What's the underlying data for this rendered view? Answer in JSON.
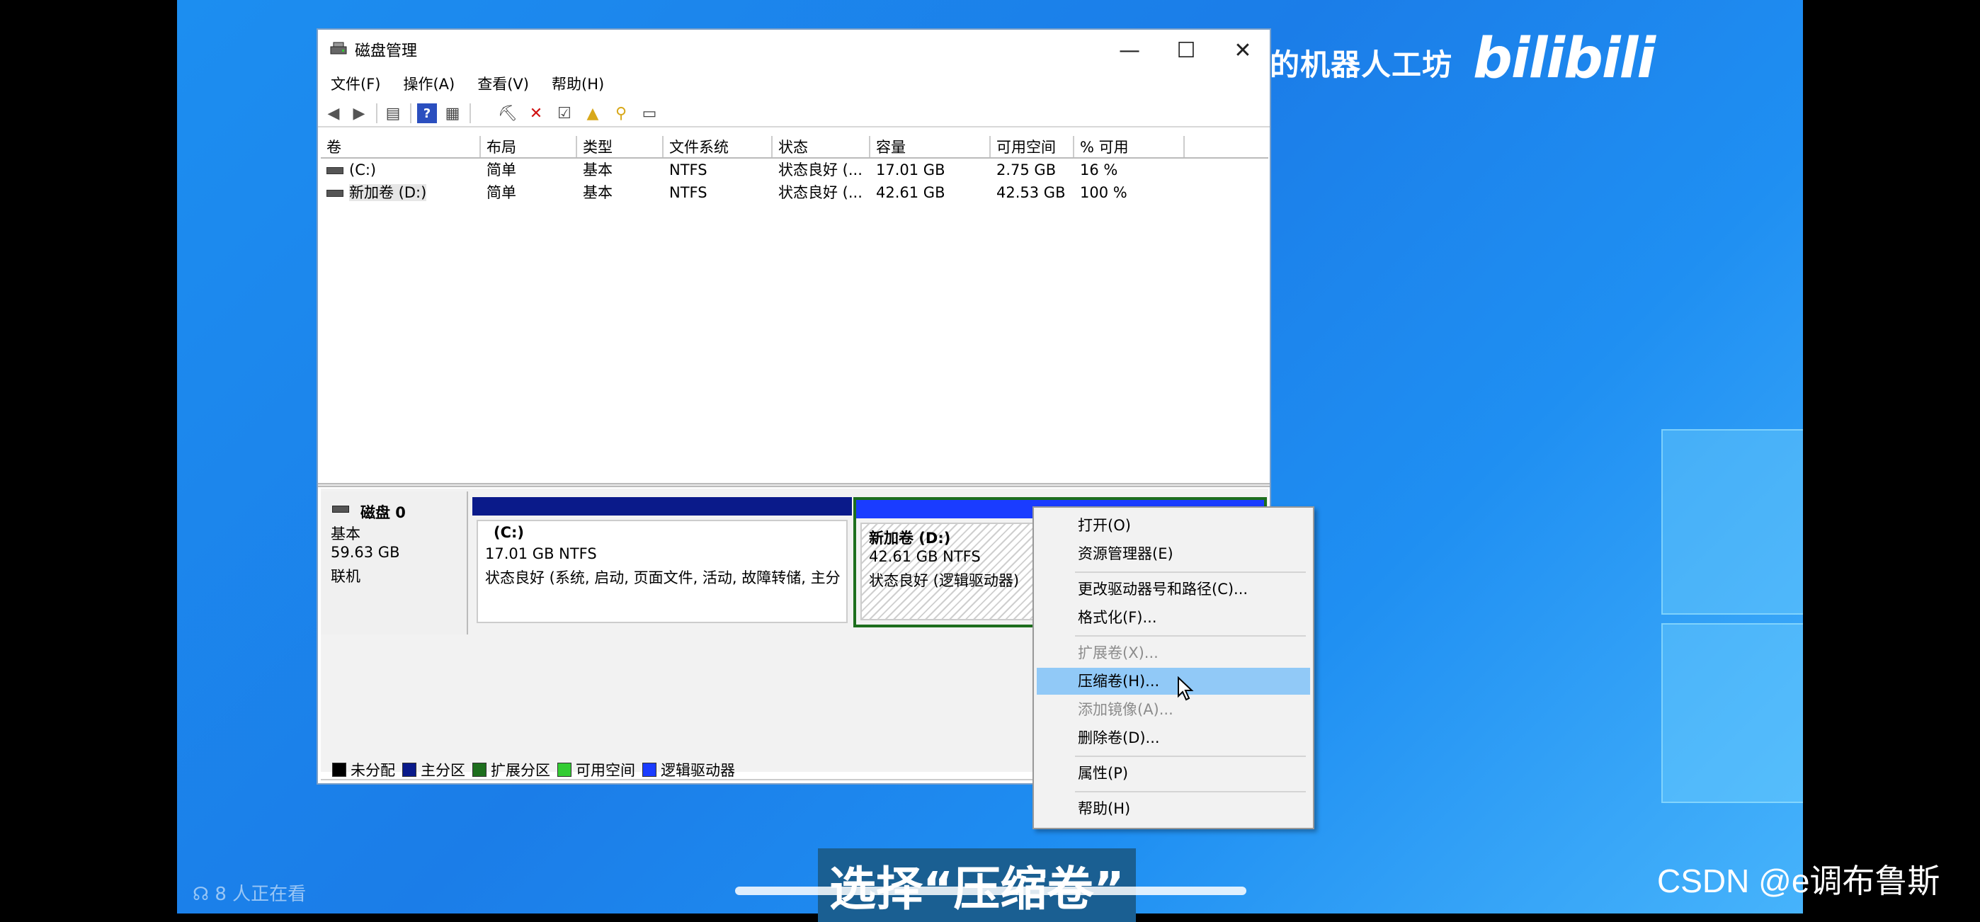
{
  "window": {
    "title": "磁盘管理"
  },
  "menu": [
    "文件(F)",
    "操作(A)",
    "查看(V)",
    "帮助(H)"
  ],
  "columns": [
    "卷",
    "布局",
    "类型",
    "文件系统",
    "状态",
    "容量",
    "可用空间",
    "% 可用"
  ],
  "volumes": [
    {
      "name": "(C:)",
      "layout": "简单",
      "type": "基本",
      "fs": "NTFS",
      "status": "状态良好 (...",
      "capacity": "17.01 GB",
      "free": "2.75 GB",
      "pct": "16 %"
    },
    {
      "name": "新加卷 (D:)",
      "layout": "简单",
      "type": "基本",
      "fs": "NTFS",
      "status": "状态良好 (...",
      "capacity": "42.61 GB",
      "free": "42.53 GB",
      "pct": "100 %"
    }
  ],
  "disk": {
    "name": "磁盘 0",
    "type": "基本",
    "size": "59.63 GB",
    "state": "联机"
  },
  "partitions": {
    "c": {
      "title": "(C:)",
      "size": "17.01 GB NTFS",
      "status": "状态良好 (系统, 启动, 页面文件, 活动, 故障转储, 主分"
    },
    "d": {
      "title": "新加卷  (D:)",
      "size": "42.61 GB NTFS",
      "status": "状态良好 (逻辑驱动器)"
    }
  },
  "legend": [
    {
      "label": "未分配",
      "color": "#000000"
    },
    {
      "label": "主分区",
      "color": "#0a1a8a"
    },
    {
      "label": "扩展分区",
      "color": "#1d6e1d"
    },
    {
      "label": "可用空间",
      "color": "#33cc33"
    },
    {
      "label": "逻辑驱动器",
      "color": "#1a3cff"
    }
  ],
  "context_menu": {
    "open": "打开(O)",
    "explorer": "资源管理器(E)",
    "change_letter": "更改驱动器号和路径(C)...",
    "format": "格式化(F)...",
    "extend": "扩展卷(X)...",
    "shrink": "压缩卷(H)...",
    "mirror": "添加镜像(A)...",
    "delete": "删除卷(D)...",
    "properties": "属性(P)",
    "help": "帮助(H)"
  },
  "overlay": {
    "watermark": "杰哥的机器人工坊",
    "logo": "bilibili",
    "subtitle": "选择“压缩卷”",
    "csdn": "CSDN @e调布鲁斯",
    "viewers": "8 人正在看"
  },
  "colors": {
    "primary_bar": "#0a1a8a",
    "logical_bar": "#1a3cff",
    "extended_border": "#1d6e1d",
    "menu_highlight": "#91c9f7"
  }
}
